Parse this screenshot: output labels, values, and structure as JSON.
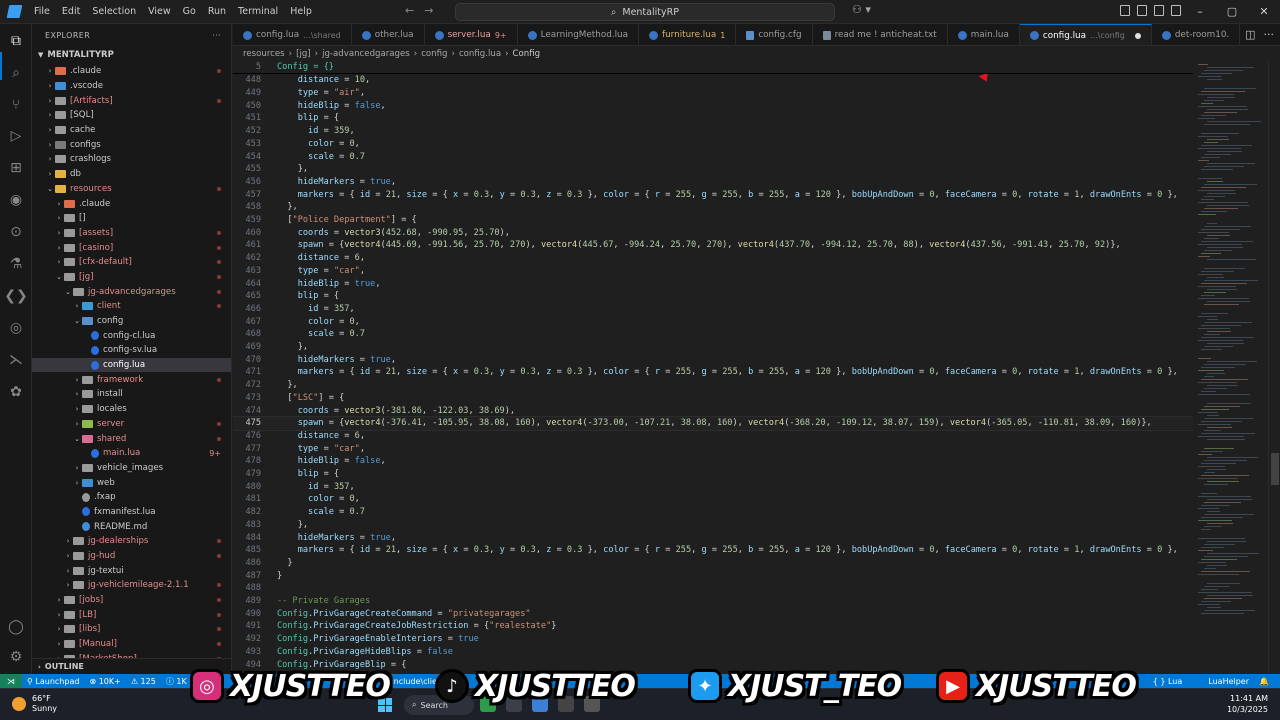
{
  "titlebar": {
    "menu": [
      "File",
      "Edit",
      "Selection",
      "View",
      "Go",
      "Run",
      "Terminal",
      "Help"
    ],
    "search_text": "MentalityRP"
  },
  "sidebar": {
    "header": "EXPLORER",
    "root": "MENTALITYRP",
    "outline": "OUTLINE",
    "items": [
      {
        "label": ".claude",
        "depth": 1,
        "type": "folder",
        "color": "#e06c4a",
        "dot": true
      },
      {
        "label": ".vscode",
        "depth": 1,
        "type": "folder",
        "color": "#3f8ed6"
      },
      {
        "label": "[Artifacts]",
        "depth": 1,
        "type": "folder",
        "color": "#9a9a9a",
        "err": true,
        "dot": true
      },
      {
        "label": "[SQL]",
        "depth": 1,
        "type": "folder",
        "color": "#9a9a9a"
      },
      {
        "label": "cache",
        "depth": 1,
        "type": "folder",
        "color": "#9a9a9a"
      },
      {
        "label": "configs",
        "depth": 1,
        "type": "folder",
        "color": "#7a7a7a"
      },
      {
        "label": "crashlogs",
        "depth": 1,
        "type": "folder",
        "color": "#9a9a9a"
      },
      {
        "label": "db",
        "depth": 1,
        "type": "folder",
        "color": "#e2b340"
      },
      {
        "label": "resources",
        "depth": 1,
        "type": "folder-open",
        "color": "#e2b340",
        "err": true,
        "dot": true
      },
      {
        "label": ".claude",
        "depth": 2,
        "type": "folder",
        "color": "#e06c4a"
      },
      {
        "label": "[]",
        "depth": 2,
        "type": "folder",
        "color": "#9a9a9a"
      },
      {
        "label": "[assets]",
        "depth": 2,
        "type": "folder",
        "color": "#9a9a9a",
        "err": true,
        "dot": true
      },
      {
        "label": "[casino]",
        "depth": 2,
        "type": "folder",
        "color": "#9a9a9a",
        "err": true,
        "dot": true
      },
      {
        "label": "[cfx-default]",
        "depth": 2,
        "type": "folder",
        "color": "#9a9a9a",
        "err": true,
        "dot": true
      },
      {
        "label": "[jg]",
        "depth": 2,
        "type": "folder-open",
        "color": "#9a9a9a",
        "err": true,
        "dot": true
      },
      {
        "label": "jg-advancedgarages",
        "depth": 3,
        "type": "folder-open",
        "color": "#9a9a9a",
        "err": true,
        "dot": true
      },
      {
        "label": "client",
        "depth": 4,
        "type": "folder",
        "color": "#3a9bd6",
        "err": true,
        "dot": true
      },
      {
        "label": "config",
        "depth": 4,
        "type": "folder-open",
        "color": "#5a8fc7"
      },
      {
        "label": "config-cl.lua",
        "depth": 5,
        "type": "file",
        "color": "#2a6fdb"
      },
      {
        "label": "config-sv.lua",
        "depth": 5,
        "type": "file",
        "color": "#2a6fdb"
      },
      {
        "label": "config.lua",
        "depth": 5,
        "type": "file",
        "color": "#2a6fdb",
        "active": true
      },
      {
        "label": "framework",
        "depth": 4,
        "type": "folder",
        "color": "#9a9a9a",
        "err": true,
        "dot": true
      },
      {
        "label": "install",
        "depth": 4,
        "type": "folder",
        "color": "#9a9a9a"
      },
      {
        "label": "locales",
        "depth": 4,
        "type": "folder",
        "color": "#9a9a9a"
      },
      {
        "label": "server",
        "depth": 4,
        "type": "folder",
        "color": "#8fb94a",
        "err": true,
        "dot": true
      },
      {
        "label": "shared",
        "depth": 4,
        "type": "folder-open",
        "color": "#d96b94",
        "err": true,
        "dot": true
      },
      {
        "label": "main.lua",
        "depth": 5,
        "type": "file",
        "color": "#2a6fdb",
        "err": true,
        "badge": "9+"
      },
      {
        "label": "vehicle_images",
        "depth": 4,
        "type": "folder",
        "color": "#9a9a9a"
      },
      {
        "label": "web",
        "depth": 4,
        "type": "folder",
        "color": "#3f8ed6"
      },
      {
        "label": ".fxap",
        "depth": 4,
        "type": "file",
        "color": "#9a9a9a"
      },
      {
        "label": "fxmanifest.lua",
        "depth": 4,
        "type": "file",
        "color": "#2a6fdb"
      },
      {
        "label": "README.md",
        "depth": 4,
        "type": "file",
        "color": "#3f8ed6"
      },
      {
        "label": "jg-dealerships",
        "depth": 3,
        "type": "folder",
        "color": "#9a9a9a",
        "err": true,
        "dot": true
      },
      {
        "label": "jg-hud",
        "depth": 3,
        "type": "folder",
        "color": "#9a9a9a",
        "err": true,
        "dot": true
      },
      {
        "label": "jg-textui",
        "depth": 3,
        "type": "folder",
        "color": "#9a9a9a"
      },
      {
        "label": "jg-vehiclemileage-2.1.1",
        "depth": 3,
        "type": "folder",
        "color": "#9a9a9a",
        "err": true,
        "dot": true
      },
      {
        "label": "[jobs]",
        "depth": 2,
        "type": "folder",
        "color": "#9a9a9a",
        "err": true,
        "dot": true
      },
      {
        "label": "[LB]",
        "depth": 2,
        "type": "folder",
        "color": "#9a9a9a",
        "err": true,
        "dot": true
      },
      {
        "label": "[libs]",
        "depth": 2,
        "type": "folder",
        "color": "#9a9a9a",
        "err": true,
        "dot": true
      },
      {
        "label": "[Manual]",
        "depth": 2,
        "type": "folder",
        "color": "#9a9a9a",
        "err": true,
        "dot": true
      },
      {
        "label": "[MarketShop]",
        "depth": 2,
        "type": "folder",
        "color": "#9a9a9a",
        "err": true,
        "dot": true
      }
    ]
  },
  "tabs": [
    {
      "label": "config.lua",
      "hint": "...\\shared",
      "icon": "lua"
    },
    {
      "label": "other.lua",
      "hint": "",
      "icon": "lua"
    },
    {
      "label": "server.lua",
      "hint": "9+",
      "icon": "lua",
      "state": "err"
    },
    {
      "label": "LearningMethod.lua",
      "hint": "",
      "icon": "lua"
    },
    {
      "label": "furniture.lua",
      "hint": "1",
      "icon": "lua",
      "state": "warn"
    },
    {
      "label": "config.cfg",
      "hint": "",
      "icon": "cfg"
    },
    {
      "label": "read me ! anticheat.txt",
      "hint": "",
      "icon": "txt"
    },
    {
      "label": "main.lua",
      "hint": "",
      "icon": "lua"
    },
    {
      "label": "config.lua",
      "hint": "...\\config",
      "icon": "lua",
      "active": true,
      "modified": true
    },
    {
      "label": "det-room10.",
      "hint": "",
      "icon": "lua"
    }
  ],
  "breadcrumb": [
    "resources",
    "[jg]",
    "jg-advancedgarages",
    "config",
    "config.lua",
    "Config"
  ],
  "editor": {
    "sticky": {
      "num": "5",
      "text": "Config = {}"
    },
    "current_line": 475,
    "lines": [
      {
        "n": 448,
        "t": "    distance = 10,"
      },
      {
        "n": 449,
        "t": "    type = \"air\","
      },
      {
        "n": 450,
        "t": "    hideBlip = false,"
      },
      {
        "n": 451,
        "t": "    blip = {"
      },
      {
        "n": 452,
        "t": "      id = 359,"
      },
      {
        "n": 453,
        "t": "      color = 0,"
      },
      {
        "n": 454,
        "t": "      scale = 0.7"
      },
      {
        "n": 455,
        "t": "    },"
      },
      {
        "n": 456,
        "t": "    hideMarkers = true,"
      },
      {
        "n": 457,
        "t": "    markers = { id = 21, size = { x = 0.3, y = 0.3, z = 0.3 }, color = { r = 255, g = 255, b = 255, a = 120 }, bobUpAndDown = 0, faceCamera = 0, rotate = 1, drawOnEnts = 0 },"
      },
      {
        "n": 458,
        "t": "  },"
      },
      {
        "n": 459,
        "t": "  [\"Police Department\"] = {"
      },
      {
        "n": 460,
        "t": "    coords = vector3(452.68, -990.95, 25.70),"
      },
      {
        "n": 461,
        "t": "    spawn = {vector4(445.69, -991.56, 25.70, 270), vector4(445.67, -994.24, 25.70, 270), vector4(437.70, -994.12, 25.70, 88), vector4(437.56, -991.43, 25.70, 92)},"
      },
      {
        "n": 462,
        "t": "    distance = 6,"
      },
      {
        "n": 463,
        "t": "    type = \"car\","
      },
      {
        "n": 464,
        "t": "    hideBlip = true,"
      },
      {
        "n": 465,
        "t": "    blip = {"
      },
      {
        "n": 466,
        "t": "      id = 357,"
      },
      {
        "n": 467,
        "t": "      color = 0,"
      },
      {
        "n": 468,
        "t": "      scale = 0.7"
      },
      {
        "n": 469,
        "t": "    },"
      },
      {
        "n": 470,
        "t": "    hideMarkers = true,"
      },
      {
        "n": 471,
        "t": "    markers = { id = 21, size = { x = 0.3, y = 0.3, z = 0.3 }, color = { r = 255, g = 255, b = 255, a = 120 }, bobUpAndDown = 0, faceCamera = 0, rotate = 1, drawOnEnts = 0 },"
      },
      {
        "n": 472,
        "t": "  },"
      },
      {
        "n": 473,
        "t": "  [\"LSC\"] = {"
      },
      {
        "n": 474,
        "t": "    coords = vector3(-381.86, -122.03, 38.69),"
      },
      {
        "n": 475,
        "t": "    spawn = {vector4(-376.41, -105.95, 38.08, 160), vector4(-373.00, -107.21, 38.08, 160), vector4(-368.20, -109.12, 38.07, 159), vector4(-365.05, -110.81, 38.09, 160)},"
      },
      {
        "n": 476,
        "t": "    distance = 6,"
      },
      {
        "n": 477,
        "t": "    type = \"car\","
      },
      {
        "n": 478,
        "t": "    hideBlip = false,"
      },
      {
        "n": 479,
        "t": "    blip = {"
      },
      {
        "n": 480,
        "t": "      id = 357,"
      },
      {
        "n": 481,
        "t": "      color = 0,"
      },
      {
        "n": 482,
        "t": "      scale = 0.7"
      },
      {
        "n": 483,
        "t": "    },"
      },
      {
        "n": 484,
        "t": "    hideMarkers = true,"
      },
      {
        "n": 485,
        "t": "    markers = { id = 21, size = { x = 0.3, y = 0.3, z = 0.3 }, color = { r = 255, g = 255, b = 255, a = 120 }, bobUpAndDown = 0, faceCamera = 0, rotate = 1, drawOnEnts = 0 },"
      },
      {
        "n": 486,
        "t": "  }"
      },
      {
        "n": 487,
        "t": "}"
      },
      {
        "n": 488,
        "t": ""
      },
      {
        "n": 489,
        "t": "-- Private Garages"
      },
      {
        "n": 490,
        "t": "Config.PrivGarageCreateCommand = \"privategarages\""
      },
      {
        "n": 491,
        "t": "Config.PrivGarageCreateJobRestriction = {\"realestate\"}"
      },
      {
        "n": 492,
        "t": "Config.PrivGarageEnableInteriors = true"
      },
      {
        "n": 493,
        "t": "Config.PrivGarageHideBlips = false"
      },
      {
        "n": 494,
        "t": "Config.PrivGarageBlip = {"
      }
    ]
  },
  "statusbar": {
    "launchpad": "Launchpad",
    "count1": "10K+",
    "count2": "125",
    "count3": "1K",
    "path": "\\include\\clie",
    "eol": "LF",
    "lang": "Lua",
    "helper": "LuaHelper"
  },
  "taskbar": {
    "temp": "66°F",
    "weather": "Sunny",
    "search": "Search",
    "time": "11:41 AM",
    "date": "10/3/2025"
  },
  "social": {
    "instagram": "XJUSTTEO",
    "tiktok": "XJUSTTEO",
    "twitter": "XJUST_TEO",
    "youtube": "XJUSTTEO"
  },
  "colors": {
    "accent": "#0078d4",
    "keyword": "#569cd6",
    "string": "#ce9178",
    "number": "#b5cea8",
    "function": "#dcdcaa",
    "comment": "#6a9955"
  }
}
